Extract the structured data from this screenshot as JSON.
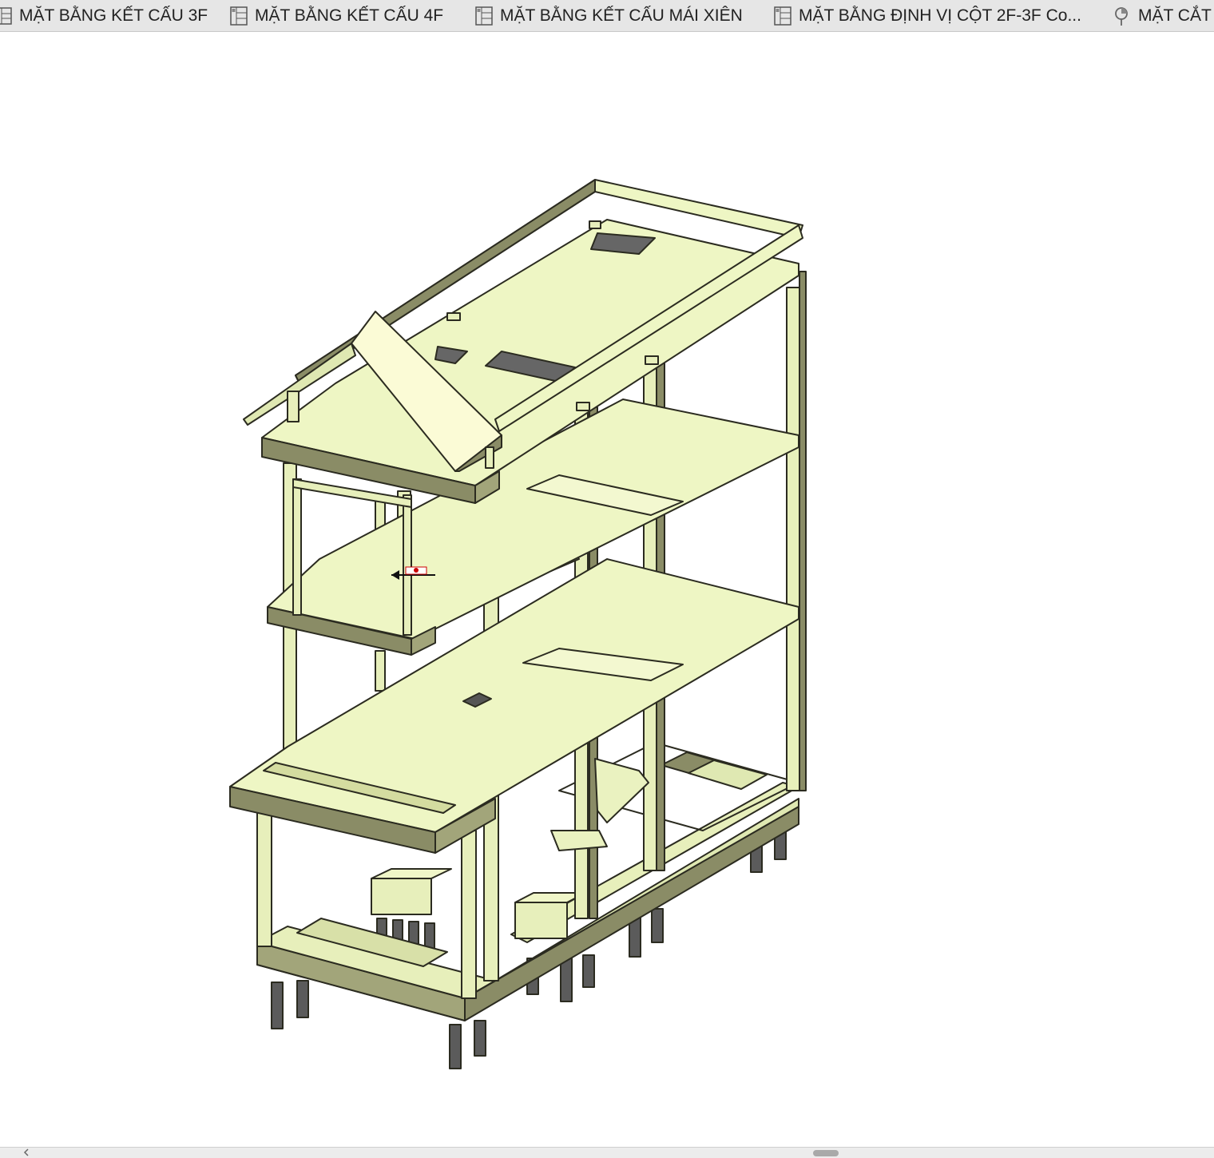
{
  "tabs": [
    {
      "label": "MẶT BẰNG KẾT CẤU 3F",
      "icon": "plan-view-icon"
    },
    {
      "label": "MẶT BẰNG KẾT CẤU 4F",
      "icon": "plan-view-icon"
    },
    {
      "label": "MẶT BẰNG KẾT CẤU MÁI XIÊN",
      "icon": "plan-view-icon"
    },
    {
      "label": "MẶT BẰNG ĐỊNH VỊ CỘT 2F-3F Co...",
      "icon": "plan-view-icon"
    },
    {
      "label": "MẶT CẮT",
      "icon": "section-view-icon"
    }
  ],
  "viewport": {
    "content": "3d-structural-model",
    "colors": {
      "slab": "#eef6c4",
      "beam_side": "#8a8c66",
      "column_face": "#e7efbb",
      "edge": "#2b2b20",
      "pile": "#555555"
    }
  }
}
